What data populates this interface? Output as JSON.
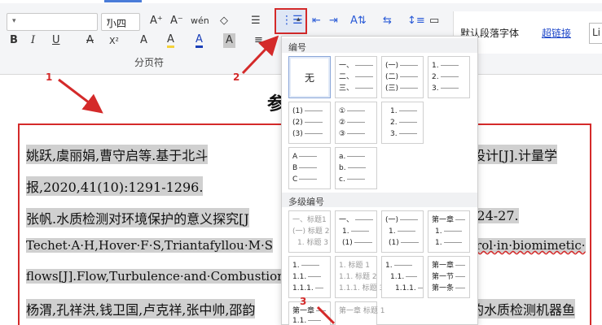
{
  "ribbon": {
    "font_size": "小四",
    "font_name": "",
    "paragraph_label": "分页符",
    "style_normal": "默认段落字体",
    "style_link": "超链接",
    "style_partial": "Li",
    "buttons": {
      "bold": "B",
      "italic": "I",
      "underline": "U",
      "strike": "A",
      "superscript": "X²",
      "grow": "A⁺",
      "shrink": "A⁻",
      "pinyin": "wén",
      "clear": "◇",
      "highlight": "A",
      "font_color": "A",
      "char_shade": "A"
    }
  },
  "dropdown": {
    "section_numbering": "编号",
    "section_multilevel": "多级编号",
    "none_label": "无",
    "tiles": {
      "t_chinese": [
        "一、",
        "二、",
        "三、"
      ],
      "t_paren_chinese": [
        "(一)",
        "(二)",
        "(三)"
      ],
      "t_arabic": [
        "1.",
        "2.",
        "3."
      ],
      "t_paren_arabic": [
        "(1)",
        "(2)",
        "(3)"
      ],
      "t_circle": [
        "①",
        "②",
        "③"
      ],
      "t_arabic2": [
        "1.",
        "2.",
        "3."
      ],
      "t_upper": [
        "A",
        "B",
        "C"
      ],
      "t_lower": [
        "a.",
        "b.",
        "c."
      ]
    },
    "multilevel": {
      "m1": [
        "一、标题1",
        "(一) 标题 2",
        "1. 标题 3"
      ],
      "m2": [
        "一、",
        "1.",
        "(1)"
      ],
      "m3": [
        "(一)",
        "1.",
        "(1)"
      ],
      "m4": [
        "第一章",
        "1.",
        "1."
      ],
      "m5": [
        "1.",
        "1.1.",
        "1.1.1."
      ],
      "m6": [
        "1. 标题 1",
        "1.1. 标题 2",
        "1.1.1. 标题 3"
      ],
      "m7": [
        "1.",
        "1.1.",
        "1.1.1."
      ],
      "m8": [
        "第一章",
        "第一节",
        "第一条"
      ],
      "m9": [
        "第一章",
        "1.1."
      ],
      "m10": [
        "第一章 标题 1"
      ]
    }
  },
  "document": {
    "heading_char": "参",
    "l1": "姚跃,虞丽娟,曹守启等.基于北斗",
    "l1r": "设计[J].计量学",
    "l2": "报,2020,41(10):1291-1296.",
    "l3": "张帆.水质检测对环境保护的意义探究[J",
    "l3r": ":24-27.",
    "l4": "Techet·A·H,Hover·F·S,Triantafyllou·M·S",
    "l4r": "trol·in·biomimetic·",
    "l5": "flows[J].Flow,Turbulence·and·Combustion",
    "l6": "杨渭,孔祥洪,钱卫国,卢克祥,张中帅,邵韵",
    "l6r": "的水质检测机器鱼"
  },
  "annotations": {
    "n1": "1",
    "n2": "2",
    "n3": "3",
    "color": "#d42a2a"
  }
}
